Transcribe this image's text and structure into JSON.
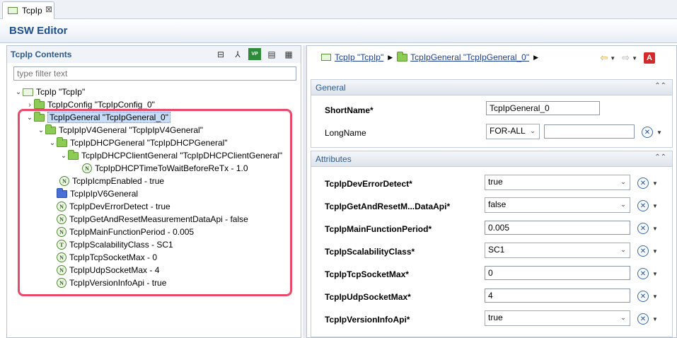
{
  "tab": {
    "label": "TcpIp",
    "close": "⊠"
  },
  "editor": {
    "title": "BSW Editor"
  },
  "left": {
    "title": "TcpIp Contents",
    "filter_placeholder": "type filter text",
    "toolbar": [
      "collapse-all-icon",
      "hierarchy-icon",
      "vp-res-icon",
      "document-icon",
      "grid-icon"
    ],
    "toolbar_labels": [
      "⊟",
      "⅄",
      "VP",
      "▤",
      "▦"
    ],
    "tree": [
      {
        "label": "TcpIp \"TcpIp\""
      },
      {
        "label": "TcpIpConfig \"TcpIpConfig_0\""
      },
      {
        "label": "TcpIpGeneral \"TcpIpGeneral_0\""
      },
      {
        "label": "TcpIpIpV4General \"TcpIpIpV4General\""
      },
      {
        "label": "TcpIpDHCPGeneral \"TcpIpDHCPGeneral\""
      },
      {
        "label": "TcpIpDHCPClientGeneral \"TcpIpDHCPClientGeneral\""
      },
      {
        "label": "TcpIpDHCPTimeToWaitBeforeReTx - 1.0",
        "badge": "N"
      },
      {
        "label": "TcpIpIcmpEnabled - true",
        "badge": "N"
      },
      {
        "label": "TcpIpIpV6General"
      },
      {
        "label": "TcpIpDevErrorDetect - true",
        "badge": "N"
      },
      {
        "label": "TcpIpGetAndResetMeasurementDataApi - false",
        "badge": "N"
      },
      {
        "label": "TcpIpMainFunctionPeriod - 0.005",
        "badge": "N"
      },
      {
        "label": "TcpIpScalabilityClass - SC1",
        "badge": "T"
      },
      {
        "label": "TcpIpTcpSocketMax - 0",
        "badge": "N"
      },
      {
        "label": "TcpIpUdpSocketMax - 4",
        "badge": "N"
      },
      {
        "label": "TcpIpVersionInfoApi - true",
        "badge": "N"
      }
    ]
  },
  "right": {
    "breadcrumb": [
      "TcpIp \"TcpIp\"",
      "TcpIpGeneral \"TcpIpGeneral_0\""
    ],
    "general": {
      "title": "General",
      "shortname_label": "ShortName*",
      "shortname_value": "TcpIpGeneral_0",
      "longname_label": "LongName",
      "longname_lang": "FOR-ALL",
      "longname_value": ""
    },
    "attributes": {
      "title": "Attributes",
      "rows": [
        {
          "label": "TcpIpDevErrorDetect*",
          "value": "true",
          "kind": "select"
        },
        {
          "label": "TcpIpGetAndResetM...DataApi*",
          "value": "false",
          "kind": "select"
        },
        {
          "label": "TcpIpMainFunctionPeriod*",
          "value": "0.005",
          "kind": "text"
        },
        {
          "label": "TcpIpScalabilityClass*",
          "value": "SC1",
          "kind": "select"
        },
        {
          "label": "TcpIpTcpSocketMax*",
          "value": "0",
          "kind": "text"
        },
        {
          "label": "TcpIpUdpSocketMax*",
          "value": "4",
          "kind": "text"
        },
        {
          "label": "TcpIpVersionInfoApi*",
          "value": "true",
          "kind": "select"
        }
      ]
    }
  }
}
